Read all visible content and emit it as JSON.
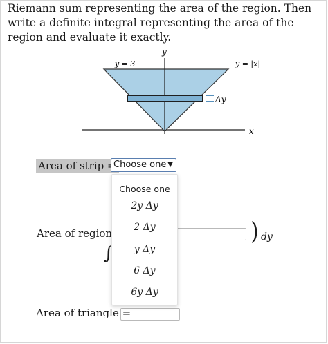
{
  "prompt": "Riemann sum representing the area of the region. Then write a definite integral representing the area of the region and evaluate it exactly.",
  "diagram": {
    "y_axis_label": "y",
    "x_axis_label": "x",
    "top_line_label": "y = 3",
    "curve_label": "y = |x|",
    "strip_label": "Δy",
    "colors": {
      "region_fill": "#abd0e6",
      "outline": "#333333",
      "strip": "#1f1f1f"
    }
  },
  "strip": {
    "label": "Area of strip =",
    "select_value": "Choose one",
    "caret": "▼",
    "dropdown": {
      "header": "Choose one",
      "options": [
        "2y Δy",
        "2 Δy",
        "y Δy",
        "6 Δy",
        "6y Δy"
      ]
    }
  },
  "region": {
    "label": "Area of region =",
    "integral_symbol": "∫",
    "close_paren": ")",
    "differential": "dy"
  },
  "triangle": {
    "label": "Area of triangle ="
  }
}
